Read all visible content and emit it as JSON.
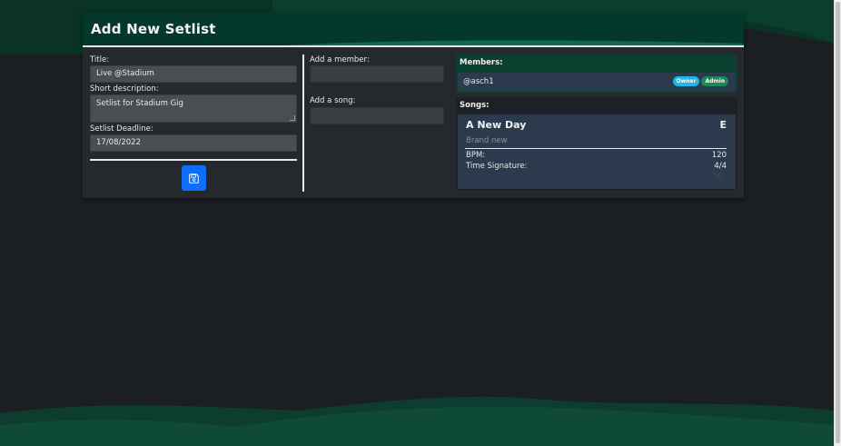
{
  "page": {
    "title": "Add New Setlist"
  },
  "form": {
    "title_label": "Title:",
    "title_value": "Live @Stadium",
    "description_label": "Short description:",
    "description_value": "Setlist for Stadium Gig",
    "deadline_label": "Setlist Deadline:",
    "deadline_value": "17/08/2022",
    "save_icon": "floppy-disk-icon"
  },
  "add": {
    "member_label": "Add a member:",
    "member_value": "",
    "song_label": "Add a song:",
    "song_value": ""
  },
  "members": {
    "heading": "Members:",
    "items": [
      {
        "name": "@asch1",
        "badges": [
          "Owner",
          "Admin"
        ]
      }
    ]
  },
  "songs": {
    "heading": "Songs:",
    "items": [
      {
        "title": "A New Day",
        "key": "E",
        "status": "Brand new",
        "bpm_label": "BPM:",
        "bpm": "120",
        "ts_label": "Time Signature:",
        "ts": "4/4"
      }
    ]
  },
  "colors": {
    "accent": "#0d6efd",
    "header": "#04382a",
    "wave": "#0e5a3f",
    "owner_badge": "#1fb7e6",
    "admin_badge": "#1a8a55"
  }
}
